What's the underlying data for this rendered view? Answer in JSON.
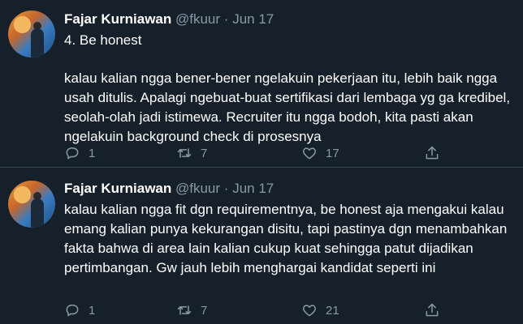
{
  "tweets": [
    {
      "author": "Fajar Kurniawan",
      "handle": "@fkuur",
      "separator": "·",
      "date": "Jun 17",
      "paragraphs": [
        "4. Be honest",
        "kalau kalian ngga bener-bener ngelakuin pekerjaan itu, lebih baik ngga usah ditulis. Apalagi ngebuat-buat sertifikasi dari lembaga yg ga kredibel, seolah-olah jadi istimewa. Recruiter itu ngga bodoh, kita pasti akan ngelakuin background check di prosesnya"
      ],
      "replies": "1",
      "retweets": "7",
      "likes": "17"
    },
    {
      "author": "Fajar Kurniawan",
      "handle": "@fkuur",
      "separator": "·",
      "date": "Jun 17",
      "paragraphs": [
        "kalau kalian ngga fit dgn requirementnya, be honest aja mengakui kalau emang kalian punya kekurangan disitu, tapi pastinya dgn menambahkan fakta bahwa di area lain kalian cukup kuat sehingga patut dijadikan pertimbangan. Gw jauh lebih menghargai kandidat seperti ini"
      ],
      "replies": "1",
      "retweets": "7",
      "likes": "21"
    }
  ],
  "icons": {
    "reply": "reply-icon",
    "retweet": "retweet-icon",
    "like": "heart-icon",
    "share": "share-icon"
  },
  "colors": {
    "background": "#15202b",
    "secondary_text": "#8899a6",
    "divider": "#38444d"
  }
}
